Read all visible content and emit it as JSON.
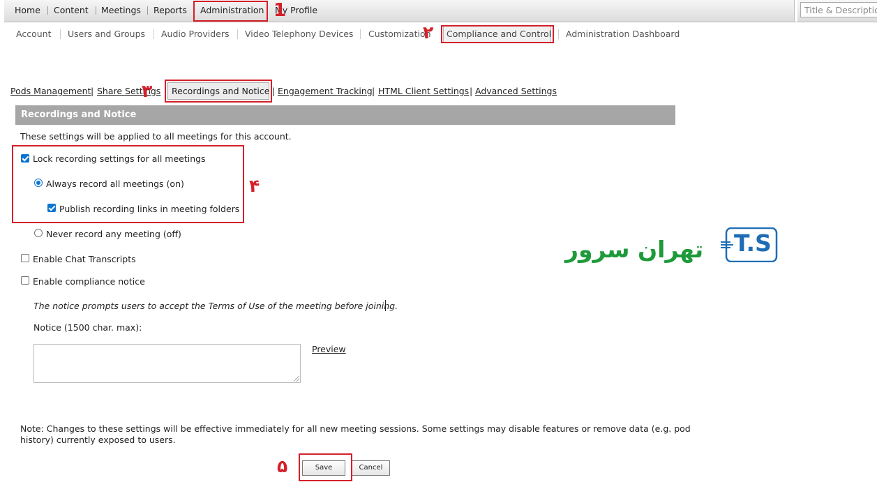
{
  "top_nav": {
    "items": [
      "Home",
      "Content",
      "Meetings",
      "Reports",
      "Administration",
      "My Profile"
    ],
    "search_placeholder": "Title & Description"
  },
  "sub_nav": {
    "items": [
      "Account",
      "Users and Groups",
      "Audio Providers",
      "Video Telephony Devices",
      "Customization",
      "Compliance and Control",
      "Administration Dashboard"
    ]
  },
  "tab_nav": {
    "items": [
      "Pods Management",
      "Share Settings",
      "Recordings and Notice",
      "Engagement Tracking",
      "HTML Client Settings",
      "Advanced Settings"
    ]
  },
  "annotations": [
    "1",
    "۲",
    "۳",
    "۴",
    "۵"
  ],
  "section": {
    "title": "Recordings and Notice",
    "intro": "These settings will be applied to all meetings for this account."
  },
  "options": {
    "lock_recording": {
      "label": "Lock recording settings for all meetings",
      "checked": true
    },
    "always_record": {
      "label": "Always record all meetings (on)",
      "checked": true
    },
    "publish_links": {
      "label": "Publish recording links in meeting folders",
      "checked": true
    },
    "never_record": {
      "label": "Never record any meeting (off)",
      "checked": false
    },
    "chat_transcripts": {
      "label": "Enable Chat Transcripts",
      "checked": false
    },
    "compliance_notice": {
      "label": "Enable compliance notice",
      "checked": false
    }
  },
  "notice": {
    "description": "The notice prompts users to accept the Terms of Use of the meeting before joining.",
    "field_label": "Notice (1500 char. max):",
    "value": "",
    "preview_label": "Preview"
  },
  "footer_note": {
    "line1": "Note: Changes to these settings will be effective immediately for all new meeting sessions. Some settings may disable features or remove data (e.g. pod",
    "line2": "history) currently exposed to users."
  },
  "buttons": {
    "save": "Save",
    "cancel": "Cancel"
  },
  "logo": {
    "latin": "T.S",
    "farsi": "تهران سرور"
  },
  "colors": {
    "accent_red": "#d4202a",
    "header_gray": "#a6a6a6",
    "logo_blue": "#1f6db5",
    "logo_green": "#1e9a3b"
  }
}
